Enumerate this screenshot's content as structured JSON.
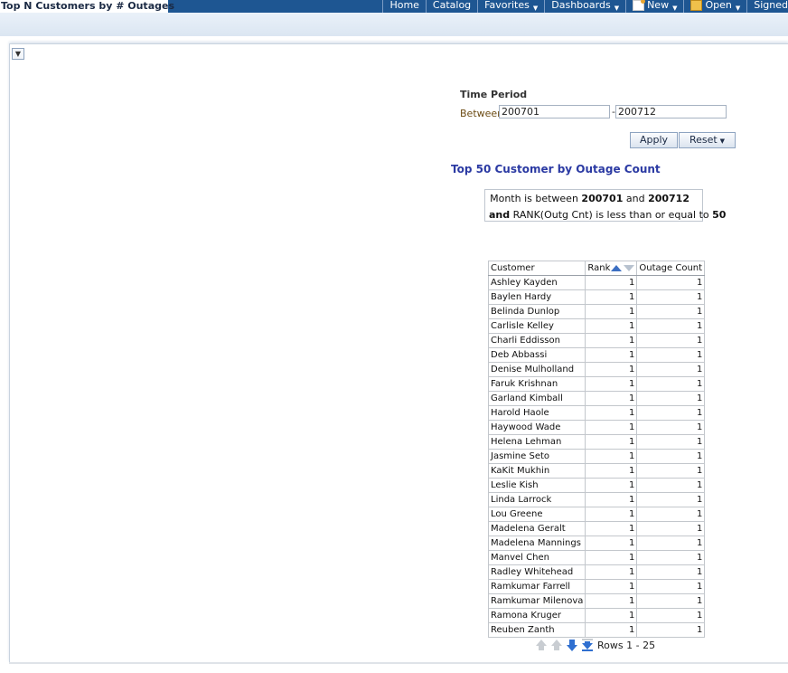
{
  "header": {
    "page_title": "Top N Customers by # Outages",
    "nav": [
      {
        "label": "Home",
        "caret": false,
        "icon": null
      },
      {
        "label": "Catalog",
        "caret": false,
        "icon": null
      },
      {
        "label": "Favorites",
        "caret": true,
        "icon": null
      },
      {
        "label": "Dashboards",
        "caret": true,
        "icon": null
      },
      {
        "label": "New",
        "caret": true,
        "icon": "new-icon"
      },
      {
        "label": "Open",
        "caret": true,
        "icon": "open-icon"
      },
      {
        "label": "Signed",
        "caret": false,
        "icon": null
      }
    ]
  },
  "prompt": {
    "section_label": "Time Period",
    "operator_label": "Between",
    "from_value": "200701",
    "to_value": "200712",
    "separator": "-",
    "apply_label": "Apply",
    "reset_label": "Reset"
  },
  "report": {
    "title": "Top 50 Customer by Outage Count",
    "filter": {
      "line1_prefix": "Month is between",
      "from": "200701",
      "and_word": "and",
      "to": "200712",
      "line2_and": "and",
      "line2_text": "RANK(Outg Cnt) is less than or equal to",
      "limit": "50"
    },
    "columns": [
      "Customer",
      "Rank",
      "Outage Count"
    ],
    "rows": [
      [
        "Ashley Kayden",
        "1",
        "1"
      ],
      [
        "Baylen Hardy",
        "1",
        "1"
      ],
      [
        "Belinda Dunlop",
        "1",
        "1"
      ],
      [
        "Carlisle Kelley",
        "1",
        "1"
      ],
      [
        "Charli Eddisson",
        "1",
        "1"
      ],
      [
        "Deb Abbassi",
        "1",
        "1"
      ],
      [
        "Denise Mulholland",
        "1",
        "1"
      ],
      [
        "Faruk Krishnan",
        "1",
        "1"
      ],
      [
        "Garland Kimball",
        "1",
        "1"
      ],
      [
        "Harold Haole",
        "1",
        "1"
      ],
      [
        "Haywood Wade",
        "1",
        "1"
      ],
      [
        "Helena Lehman",
        "1",
        "1"
      ],
      [
        "Jasmine Seto",
        "1",
        "1"
      ],
      [
        "KaKit Mukhin",
        "1",
        "1"
      ],
      [
        "Leslie Kish",
        "1",
        "1"
      ],
      [
        "Linda Larrock",
        "1",
        "1"
      ],
      [
        "Lou Greene",
        "1",
        "1"
      ],
      [
        "Madelena Geralt",
        "1",
        "1"
      ],
      [
        "Madelena Mannings",
        "1",
        "1"
      ],
      [
        "Manvel Chen",
        "1",
        "1"
      ],
      [
        "Radley Whitehead",
        "1",
        "1"
      ],
      [
        "Ramkumar Farrell",
        "1",
        "1"
      ],
      [
        "Ramkumar Milenova",
        "1",
        "1"
      ],
      [
        "Ramona Kruger",
        "1",
        "1"
      ],
      [
        "Reuben Zanth",
        "1",
        "1"
      ]
    ],
    "pager_text": "Rows 1 - 25"
  },
  "colors": {
    "header_bg": "#1e5692",
    "title_color": "#2b3aa3",
    "sort_active": "#3c6fc2"
  }
}
